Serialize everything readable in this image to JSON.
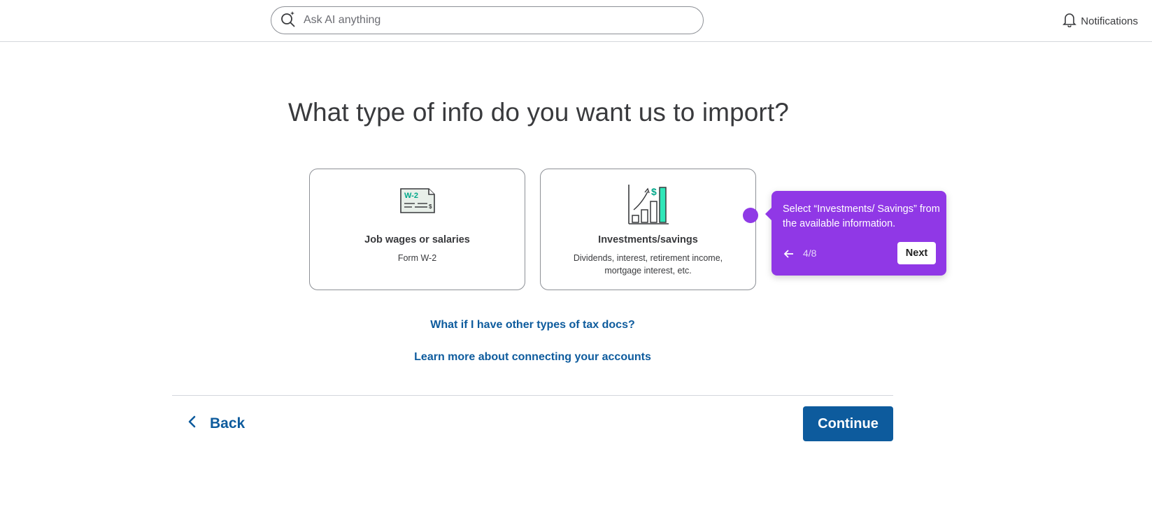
{
  "header": {
    "search_placeholder": "Ask AI anything",
    "search_icon": "ai-search-icon",
    "notifications_label": "Notifications",
    "notifications_icon": "bell-icon"
  },
  "main": {
    "title": "What type of info do you want us to import?",
    "cards": [
      {
        "title": "Job wages or salaries",
        "subtitle": "Form W-2",
        "icon": "w2-form-icon",
        "icon_label": "W-2"
      },
      {
        "title": "Investments/savings",
        "subtitle": "Dividends, interest, retirement income, mortgage interest, etc.",
        "icon": "investment-chart-icon",
        "icon_label": "$"
      }
    ],
    "links": {
      "other_docs": "What if I have other types of tax docs?",
      "learn_more": "Learn more about connecting your accounts"
    }
  },
  "footer": {
    "back_label": "Back",
    "continue_label": "Continue"
  },
  "tooltip": {
    "text": "Select “Investments/ Savings” from the available information.",
    "step": "4/8",
    "next_label": "Next"
  },
  "colors": {
    "link_blue": "#0d5b9d",
    "tooltip_purple": "#9038e6",
    "accent_green": "#00c1a0"
  }
}
